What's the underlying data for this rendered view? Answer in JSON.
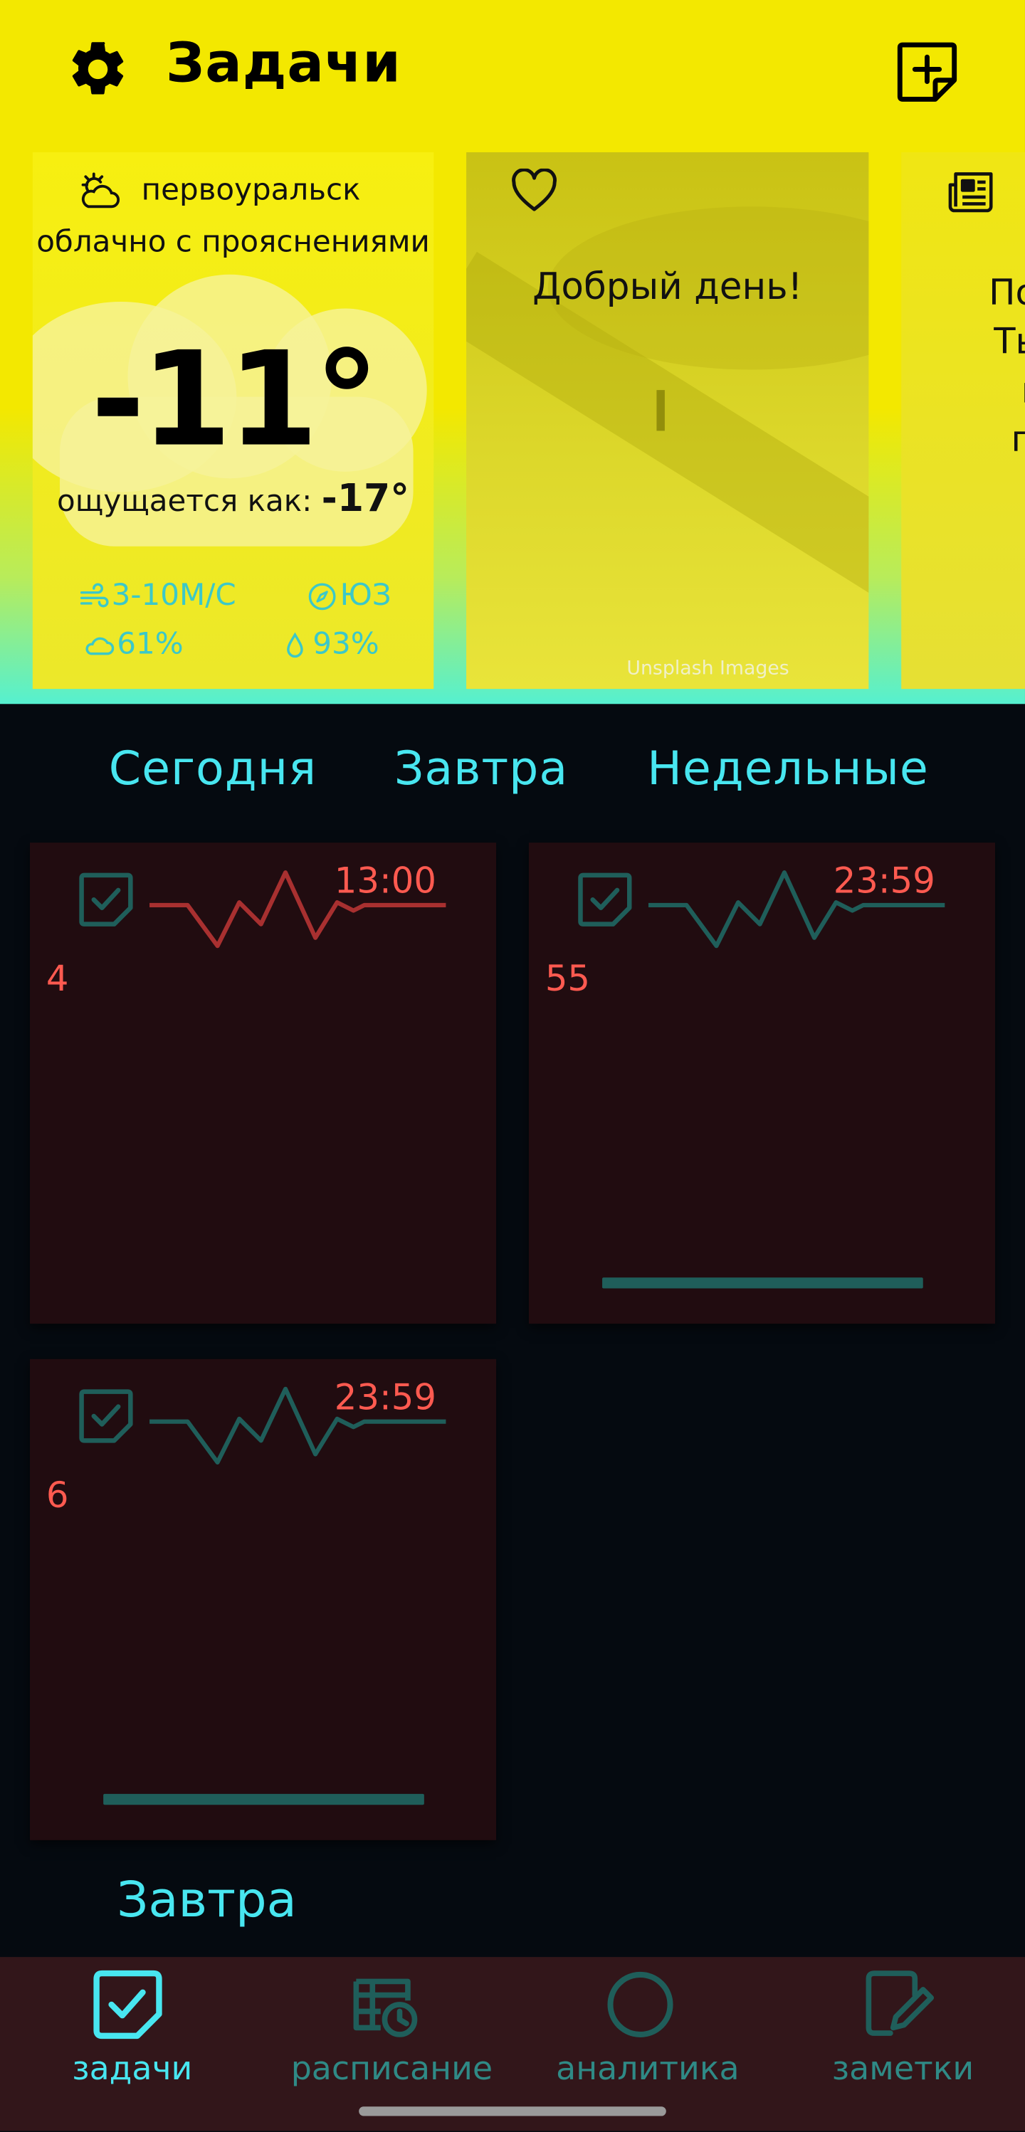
{
  "app": {
    "title": "Задачи"
  },
  "header": {
    "settings_icon": "gear-icon",
    "add_icon": "add-note-icon"
  },
  "weather": {
    "city": "первоуральск",
    "description": "облачно с прояснениями",
    "temperature": "-11°",
    "feels_like_label": "ощущается как:",
    "feels_like_value": "-17°",
    "wind": "3-10М/С",
    "direction": "ЮЗ",
    "cloudiness": "61%",
    "humidity": "93%"
  },
  "photo_card": {
    "greeting": "Добрый день!",
    "credit": "Unsplash Images"
  },
  "news_card": {
    "text_lines": [
      "Позда",
      "Ты те",
      "мо",
      "при"
    ]
  },
  "tabs": [
    {
      "label": "Сегодня"
    },
    {
      "label": "Завтра"
    },
    {
      "label": "Недельные"
    }
  ],
  "tasks": [
    {
      "time": "13:00",
      "count": "4",
      "active": true,
      "progress": 0
    },
    {
      "time": "23:59",
      "count": "55",
      "active": false,
      "progress": 1
    },
    {
      "time": "23:59",
      "count": "6",
      "active": false,
      "progress": 1
    }
  ],
  "section_next": "Завтра",
  "bottom_nav": [
    {
      "label": "задачи",
      "icon": "task-check-icon",
      "active": true
    },
    {
      "label": "расписание",
      "icon": "schedule-icon",
      "active": false
    },
    {
      "label": "аналитика",
      "icon": "circle-icon",
      "active": false
    },
    {
      "label": "заметки",
      "icon": "note-edit-icon",
      "active": false
    }
  ],
  "colors": {
    "accent_yellow": "#f3e800",
    "accent_cyan": "#48e6f0",
    "card_dark": "#210c10",
    "danger_red": "#ff5a50",
    "muted_teal": "#1f5e5a",
    "nav_bg": "#32161a"
  }
}
